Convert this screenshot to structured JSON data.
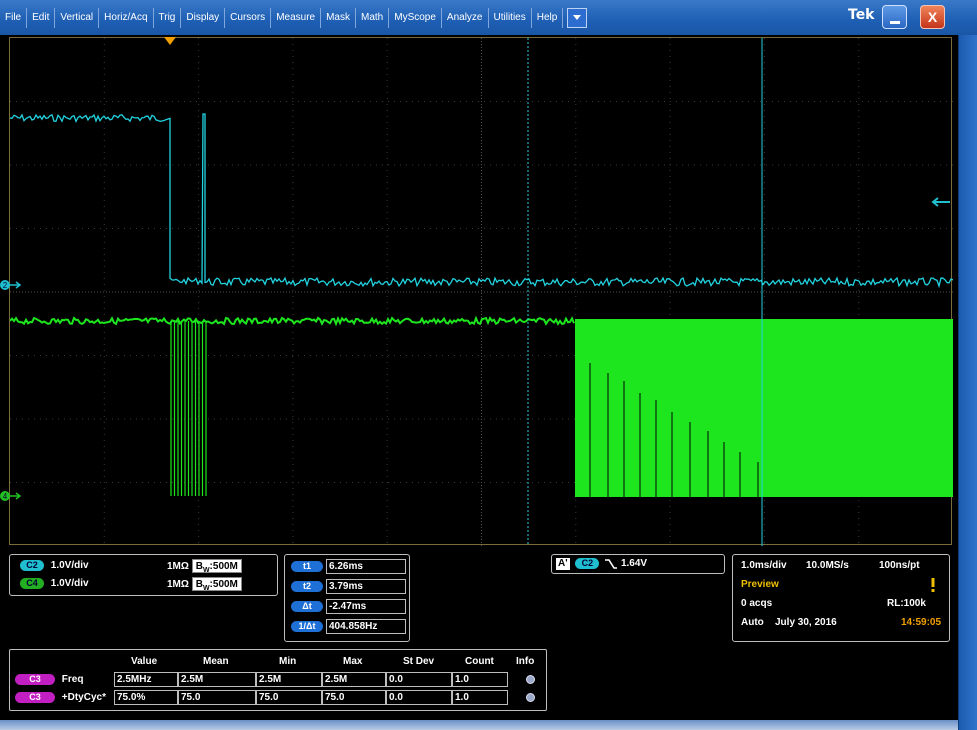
{
  "menu": {
    "items": [
      "File",
      "Edit",
      "Vertical",
      "Horiz/Acq",
      "Trig",
      "Display",
      "Cursors",
      "Measure",
      "Mask",
      "Math",
      "MyScope",
      "Analyze",
      "Utilities",
      "Help"
    ],
    "dropdown_icon": "chevron-down-icon",
    "logo": "Tek",
    "close_label": "X"
  },
  "markers": {
    "ch2": "2",
    "ch4": "4"
  },
  "channels": [
    {
      "tag": "C2",
      "scale": "1.0V/div",
      "impedance": "1MΩ",
      "bw_prefix": "B",
      "bw_sub": "W",
      "bw": ":500M",
      "color": "#1fbfcf"
    },
    {
      "tag": "C4",
      "scale": "1.0V/div",
      "impedance": "1MΩ",
      "bw_prefix": "B",
      "bw_sub": "W",
      "bw": ":500M",
      "color": "#22b022"
    }
  ],
  "cursors": [
    {
      "label": "t1",
      "value": "6.26ms"
    },
    {
      "label": "t2",
      "value": "3.79ms"
    },
    {
      "label": "Δt",
      "value": "-2.47ms"
    },
    {
      "label": "1/Δt",
      "value": "404.858Hz"
    }
  ],
  "trigger": {
    "mode": "A'",
    "source": "C2",
    "slope_icon": "falling-edge-icon",
    "level": "1.64V"
  },
  "acquisition": {
    "timebase": "1.0ms/div",
    "sample_rate": "10.0MS/s",
    "resolution": "100ns/pt",
    "state": "Preview",
    "acqs": "0 acqs",
    "record_length": "RL:100k",
    "trigger_mode": "Auto",
    "date": "July 30, 2016",
    "time": "14:59:05",
    "state_color": "#f0c000",
    "time_color": "#f0a000"
  },
  "measurements": {
    "headers": [
      "Value",
      "Mean",
      "Min",
      "Max",
      "St Dev",
      "Count",
      "Info"
    ],
    "rows": [
      {
        "source": "C3",
        "name": "Freq",
        "value": "2.5MHz",
        "mean": "2.5M",
        "min": "2.5M",
        "max": "2.5M",
        "stdev": "0.0",
        "count": "1.0"
      },
      {
        "source": "C3",
        "name": "+DtyCyc*",
        "value": "75.0%",
        "mean": "75.0",
        "min": "75.0",
        "max": "75.0",
        "stdev": "0.0",
        "count": "1.0"
      }
    ]
  },
  "colors": {
    "ch2_trace": "#22d3e0",
    "ch4_trace": "#1ee61e",
    "trigger_marker": "#f0a000",
    "menu_bar": "#1e5fb4"
  }
}
